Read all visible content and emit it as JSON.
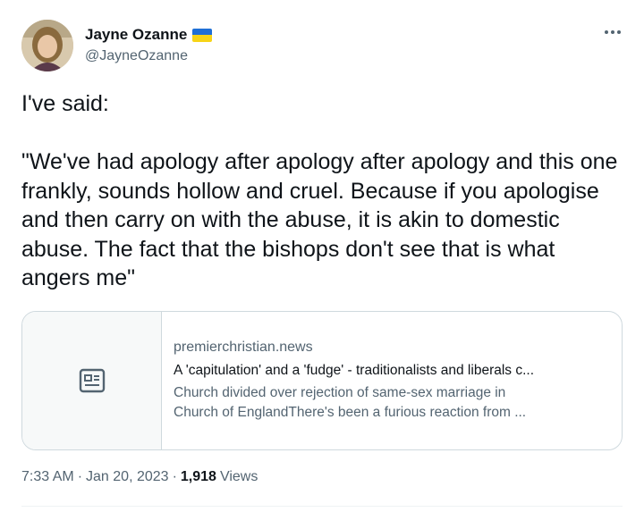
{
  "author": {
    "display_name": "Jayne Ozanne",
    "handle": "@JayneOzanne",
    "flag_icon": "ukraine-flag"
  },
  "tweet": {
    "text": "I've said:\n\n\"We've had apology after apology after apology and this one frankly, sounds hollow and cruel. Because if you apologise and then carry on with the abuse, it is akin to domestic abuse. The fact that the  bishops don't see that is what angers me\""
  },
  "link_card": {
    "domain": "premierchristian.news",
    "title": "A 'capitulation' and a 'fudge' - traditionalists and liberals c...",
    "description_line1": "Church divided over rejection of same-sex marriage in",
    "description_line2": "Church of EnglandThere's been a furious reaction from ...",
    "thumb_icon": "article-icon"
  },
  "meta": {
    "time": "7:33 AM",
    "separator": "·",
    "date": "Jan 20, 2023",
    "views_count": "1,918",
    "views_label": "Views"
  },
  "colors": {
    "text_primary": "#0f1419",
    "text_secondary": "#536471",
    "border": "#cfd9de"
  }
}
